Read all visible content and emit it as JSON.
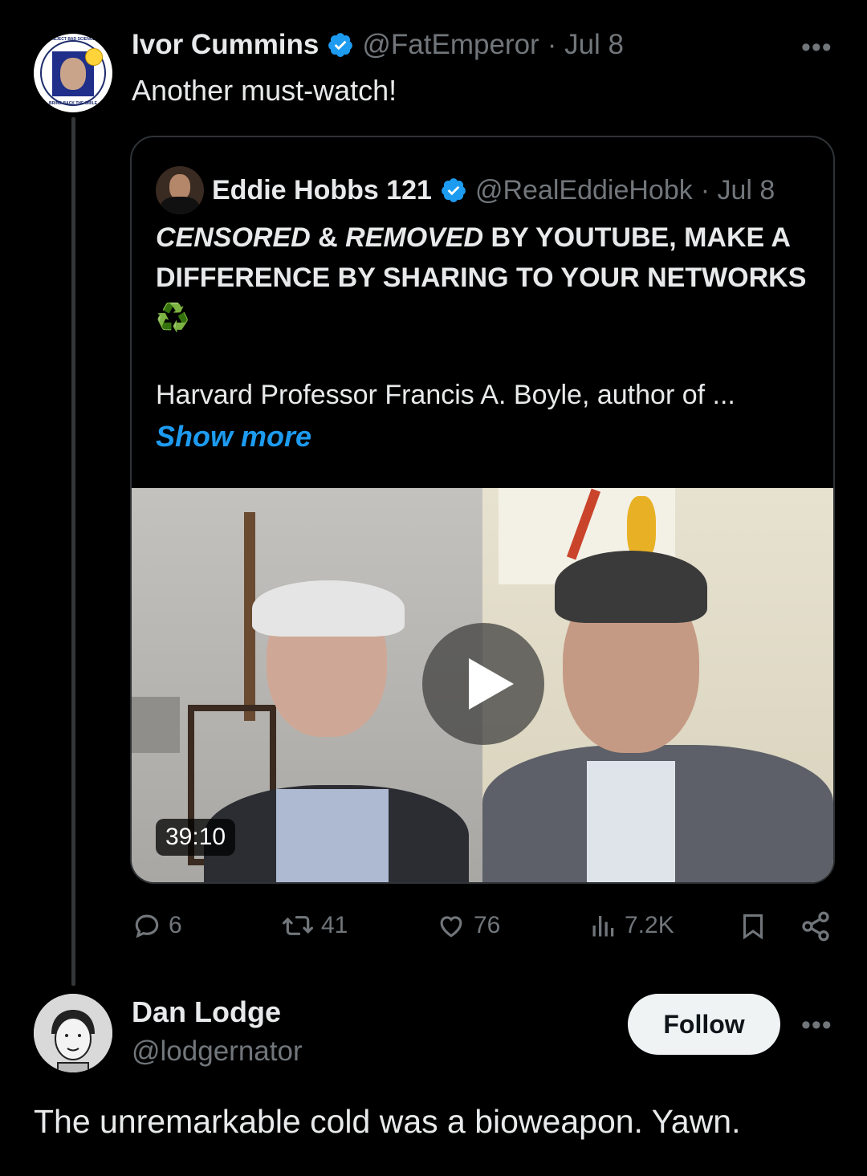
{
  "tweet": {
    "author_name": "Ivor Cummins",
    "author_handle": "@FatEmperor",
    "date": "· Jul 8",
    "text": "Another must-watch!",
    "avatar_top_text": "REJECT BAD SCIENCE",
    "avatar_bottom_text": "BRING BACK THE SMILE",
    "more_icon": "more-icon",
    "quote": {
      "author_name": "Eddie Hobbs 121",
      "author_handle": "@RealEddieHobk",
      "date": "· Jul 8",
      "headline_italic_1": "CENSORED",
      "headline_amp": " & ",
      "headline_italic_2": "REMOVED",
      "headline_rest": " BY YOUTUBE, MAKE A DIFFERENCE BY SHARING TO YOUR NETWORKS",
      "headline_emoji": "♻️",
      "body": "Harvard Professor Francis A. Boyle, author of ...",
      "show_more": "Show more",
      "video_duration": "39:10"
    },
    "actions": {
      "replies": "6",
      "reposts": "41",
      "likes": "76",
      "views": "7.2K"
    }
  },
  "reply": {
    "author_name": "Dan Lodge",
    "author_handle": "@lodgernator",
    "follow_label": "Follow",
    "text": "The unremarkable cold was a bioweapon. Yawn."
  },
  "colors": {
    "background": "#000000",
    "text": "#e7e9ea",
    "muted": "#71767b",
    "accent": "#1d9bf0"
  }
}
